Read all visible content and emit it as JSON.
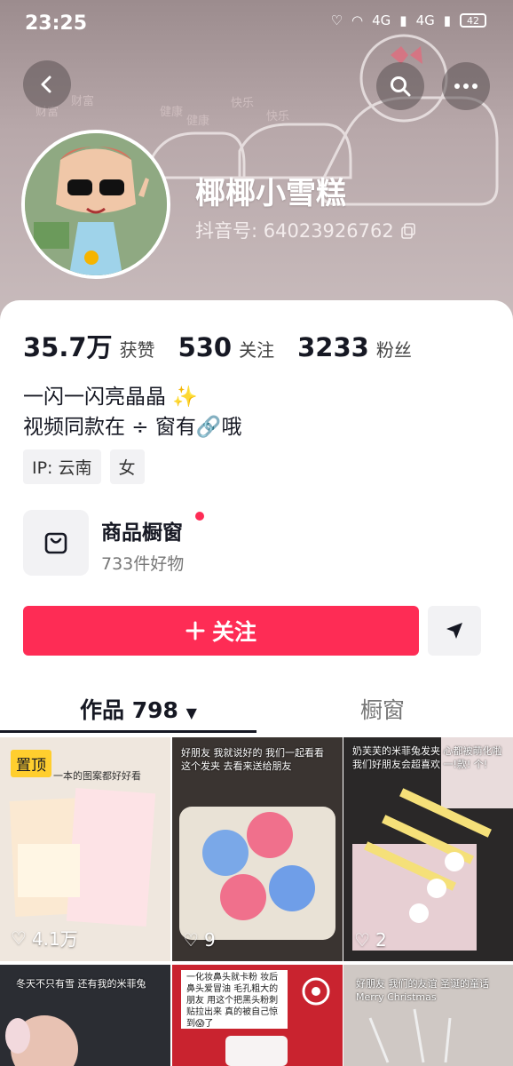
{
  "status_bar": {
    "time": "23:25",
    "network_1": "4G",
    "network_2": "4G",
    "battery": "42"
  },
  "profile": {
    "nickname": "椰椰小雪糕",
    "douyin_id": "抖音号: 64023926762"
  },
  "stats": [
    {
      "value": "35.7万",
      "label": "获赞"
    },
    {
      "value": "530",
      "label": "关注"
    },
    {
      "value": "3233",
      "label": "粉丝"
    }
  ],
  "bio": {
    "line1": "一闪一闪亮晶晶 ✨",
    "line2": "视频同款在 ÷ 窗有🔗哦"
  },
  "tags": [
    "IP: 云南",
    "女"
  ],
  "shop": {
    "title": "商品橱窗",
    "subtitle": "733件好物"
  },
  "actions": {
    "follow_label": "关注"
  },
  "tabs": {
    "works": "作品 798",
    "window": "橱窗"
  },
  "grid": [
    {
      "pinned_label": "置顶",
      "likes": "4.1万",
      "caption": "一本的图案都好好看"
    },
    {
      "likes": "9",
      "caption": "好朋友 我就说好的 我们一起看看这个发夹 去看来送给朋友"
    },
    {
      "likes": "2",
      "caption": "奶芙芙的米菲兔发夹 心都被萌化啦 我们好朋友会超喜欢 一!款! 个!"
    },
    {
      "caption": "冬天不只有雪 还有我的米菲兔"
    },
    {
      "caption": "一化妆鼻头就卡粉 妆后鼻头爱冒油 毛孔粗大的朋友 用这个把黑头粉刺贴拉出来 真的被自己惊到😱了"
    },
    {
      "caption": "好朋友 我们的友谊 圣诞的童话 Merry Christmas"
    }
  ],
  "colors": {
    "accent": "#fe2c55",
    "pin": "#ffce2e",
    "text": "#161823"
  }
}
